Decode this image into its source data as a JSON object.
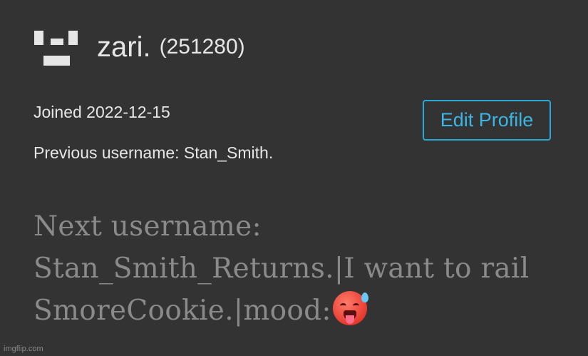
{
  "profile": {
    "username": "zari.",
    "user_id": "(251280)",
    "joined": "Joined 2022-12-15",
    "previous_username": "Previous username: Stan_Smith.",
    "edit_button": "Edit Profile",
    "bio": "Next username: Stan_Smith_Returns.|I want to rail SmoreCookie.|mood:",
    "bio_emoji": "hot-face-emoji"
  },
  "watermark": "imgflip.com",
  "colors": {
    "background": "#333333",
    "text": "#e6e6e6",
    "accent": "#29a9d7",
    "bio_text": "#8a8a8a"
  },
  "icons": {
    "site_logo": "site-logo-icon"
  }
}
